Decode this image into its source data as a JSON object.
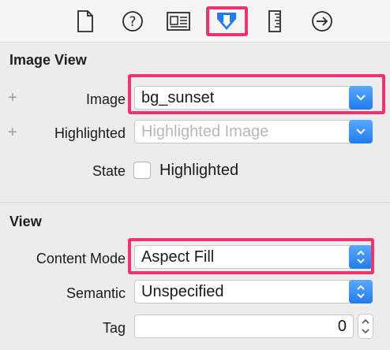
{
  "toolbar": {
    "icons": [
      "file-inspector-icon",
      "help-icon",
      "identity-icon",
      "attributes-icon",
      "size-icon",
      "connections-icon"
    ]
  },
  "image_view": {
    "title": "Image View",
    "image_label": "Image",
    "image_value": "bg_sunset",
    "highlighted_label": "Highlighted",
    "highlighted_placeholder": "Highlighted Image",
    "state_label": "State",
    "state_checkbox_label": "Highlighted"
  },
  "view": {
    "title": "View",
    "content_mode_label": "Content Mode",
    "content_mode_value": "Aspect Fill",
    "semantic_label": "Semantic",
    "semantic_value": "Unspecified",
    "tag_label": "Tag",
    "tag_value": "0"
  },
  "colors": {
    "highlight": "#f0326e",
    "accent": "#1f7cf0"
  }
}
